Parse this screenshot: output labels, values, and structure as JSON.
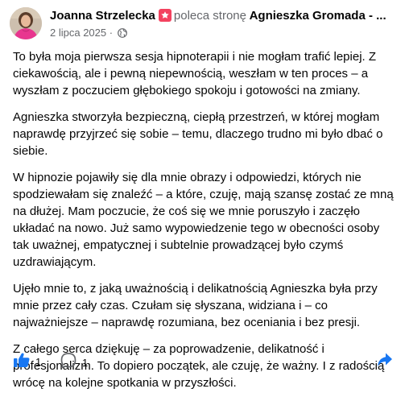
{
  "author": {
    "name": "Joanna Strzelecka",
    "action": "poleca stronę",
    "target": "Agnieszka Gromada - ...",
    "date": "2 lipca 2025",
    "separator": "·"
  },
  "post": {
    "paragraphs": [
      "To była moja pierwsza sesja hipnoterapii i nie mogłam trafić lepiej. Z ciekawością, ale i pewną niepewnością, weszłam w ten proces – a wyszłam z poczuciem głębokiego spokoju i gotowości na zmiany.",
      "Agnieszka stworzyła bezpieczną, ciepłą przestrzeń, w której mogłam naprawdę przyjrzeć się sobie – temu, dlaczego trudno mi było dbać o siebie.",
      "W hipnozie pojawiły się dla mnie obrazy i odpowiedzi, których nie spodziewałam się znaleźć – a które, czuję, mają szansę zostać ze mną na dłużej. Mam poczucie, że coś się we mnie poruszyło i zaczęło układać na nowo. Już samo wypowiedzenie tego w obecności osoby tak uważnej, empatycznej i subtelnie prowadzącej było czymś uzdrawiającym.",
      "Ujęło mnie to, z jaką uważnością i delikatnością Agnieszka była przy mnie przez cały czas. Czułam się słyszana, widziana i – co najważniejsze – naprawdę rozumiana, bez oceniania i bez presji.",
      "Z całego serca dziękuję – za poprowadzenie, delikatność i profesjonalizm. To dopiero początek, ale czuję, że ważny. I z radością wrócę na kolejne spotkania w przyszłości."
    ]
  },
  "footer": {
    "like_count": "1",
    "comment_count": "1"
  },
  "icons": {
    "recommend": "recommend-icon",
    "globe": "globe-icon",
    "like": "thumbs-up-icon",
    "comment": "comment-icon",
    "share": "share-icon"
  },
  "colors": {
    "accent": "#1877f2",
    "recommend_badge": "#f3425f",
    "secondary_text": "#65676b",
    "avatar_top": "#e8368f"
  }
}
